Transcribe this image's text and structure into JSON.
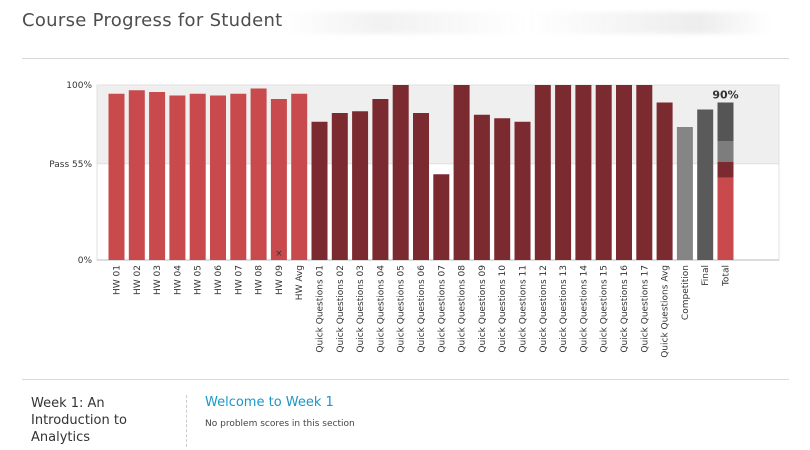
{
  "header": {
    "title": "Course Progress for Student"
  },
  "chart_data": {
    "type": "bar",
    "y_ticks": [
      "100%",
      "Pass 55%",
      "0%"
    ],
    "pass_threshold": 55,
    "ylim": [
      0,
      100
    ],
    "total_label": "90%",
    "colors": {
      "homework": "#c84a4d",
      "quick_questions": "#7b2a30",
      "competition": "#858585",
      "final": "#5a5a5a",
      "pass_band": "#efefef"
    },
    "categories": [
      "HW 01",
      "HW 02",
      "HW 03",
      "HW 04",
      "HW 05",
      "HW 06",
      "HW 07",
      "HW 08",
      "HW 09",
      "HW Avg",
      "Quick Questions 01",
      "Quick Questions 02",
      "Quick Questions 03",
      "Quick Questions 04",
      "Quick Questions 05",
      "Quick Questions 06",
      "Quick Questions 07",
      "Quick Questions 08",
      "Quick Questions 09",
      "Quick Questions 10",
      "Quick Questions 11",
      "Quick Questions 12",
      "Quick Questions 13",
      "Quick Questions 14",
      "Quick Questions 15",
      "Quick Questions 16",
      "Quick Questions 17",
      "Quick Questions Avg",
      "Competition",
      "Final",
      "Total"
    ],
    "series": [
      {
        "group": "homework",
        "values": [
          95,
          97,
          96,
          94,
          95,
          94,
          95,
          98,
          92,
          95
        ]
      },
      {
        "group": "quick_questions",
        "values": [
          79,
          84,
          85,
          92,
          100,
          84,
          49,
          100,
          83,
          81,
          79,
          100,
          100,
          100,
          100,
          100,
          100,
          90
        ]
      },
      {
        "group": "competition",
        "values": [
          76
        ]
      },
      {
        "group": "final",
        "values": [
          86
        ]
      }
    ],
    "total_stack": [
      {
        "group": "homework",
        "value": 47
      },
      {
        "group": "quick_questions",
        "value": 9
      },
      {
        "group": "competition",
        "value": 12
      },
      {
        "group": "final",
        "value": 22
      }
    ],
    "dropped_marker": {
      "category": "HW 09",
      "symbol": "×"
    }
  },
  "section": {
    "week_title": "Week 1: An Introduction to Analytics",
    "link_label": "Welcome to Week 1",
    "note": "No problem scores in this section"
  }
}
